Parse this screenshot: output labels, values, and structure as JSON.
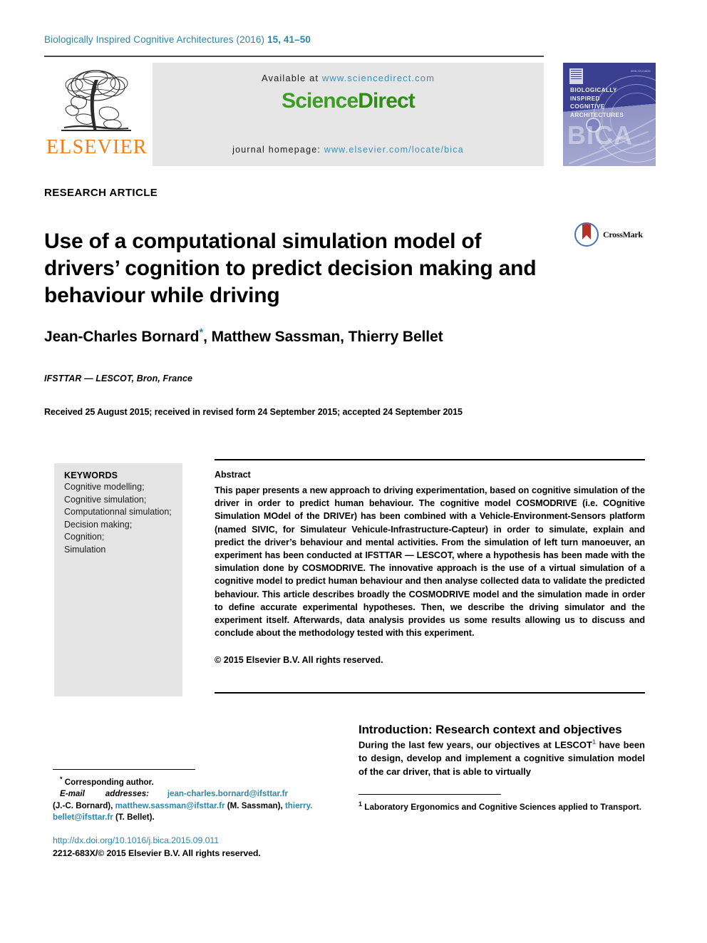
{
  "running_head": {
    "journal": "Biologically Inspired Cognitive Architectures",
    "year": "(2016)",
    "volpages": "15, 41–50"
  },
  "masthead": {
    "publisher": "ELSEVIER",
    "available_prefix": "Available at ",
    "available_url": "www.sciencedirect.com",
    "sciencedirect_part1": "Science",
    "sciencedirect_part2": "Direct",
    "homepage_prefix": "journal homepage: ",
    "homepage_url": "www.elsevier.com/locate/bica"
  },
  "cover": {
    "issn": "ISSN 2212-683X",
    "title_line1": "BIOLOGICALLY",
    "title_line2": "INSPIRED",
    "title_line3": "COGNITIVE",
    "title_line4": "ARCHITECTURES",
    "watermark": "BICA"
  },
  "article": {
    "type": "RESEARCH ARTICLE",
    "title": "Use of a computational simulation model of drivers’ cognition to predict decision making and behaviour while driving",
    "crossmark_label": "CrossMark",
    "authors": "Jean-Charles Bornard",
    "authors_rest": ", Matthew Sassman, Thierry Bellet",
    "corresponding_marker": "*",
    "affiliation": "IFSTTAR — LESCOT, Bron, France",
    "history": "Received 25 August 2015; received in revised form 24 September 2015; accepted 24 September 2015"
  },
  "keywords": {
    "heading": "KEYWORDS",
    "items": [
      "Cognitive modelling;",
      "Cognitive simulation;",
      "Computationnal simulation;",
      "Decision making;",
      "Cognition;",
      "Simulation"
    ]
  },
  "abstract": {
    "heading": "Abstract",
    "body": "This paper presents a new approach to driving experimentation, based on cognitive simulation of the driver in order to predict human behaviour. The cognitive model COSMODRIVE (i.e. COgnitive Simulation MOdel of the DRIVEr) has been combined with a Vehicle-Environment-Sensors platform (named SIVIC, for Simulateur Vehicule-Infrastructure-Capteur) in order to simulate, explain and predict the driver’s behaviour and mental activities. From the simulation of left turn manoeuver, an experiment has been conducted at IFSTTAR — LESCOT, where a hypothesis has been made with the simulation done by COSMODRIVE. The innovative approach is the use of a virtual simulation of a cognitive model to predict human behaviour and then analyse collected data to validate the predicted behaviour. This article describes broadly the COSMODRIVE model and the simulation made in order to define accurate experimental hypotheses. Then, we describe the driving simulator and the experiment itself. Afterwards, data analysis provides us some results allowing us to discuss and conclude about the methodology tested with this experiment.",
    "copyright": "© 2015 Elsevier B.V. All rights reserved."
  },
  "introduction": {
    "heading": "Introduction: Research context and objectives",
    "paragraph_part1": "During the last few years, our objectives at LESCOT",
    "footnote_marker": "1",
    "paragraph_part2": " have been to design, develop and implement a cognitive simulation model of the car driver, that is able to virtually"
  },
  "footnotes": {
    "corresponding": "Corresponding author.",
    "corresponding_marker": "*",
    "email_label": "E-mail",
    "addresses_label": "addresses:",
    "email1": "jean-charles.bornard@ifsttar.fr",
    "email1_owner": "(J.-C. Bornard), ",
    "email2": "matthew.sassman@ifsttar.fr",
    "email2_owner": " (M. Sassman), ",
    "email3a": "thierry.",
    "email3b": "bellet@ifsttar.fr",
    "email3_owner": " (T. Bellet).",
    "doi": "http://dx.doi.org/10.1016/j.bica.2015.09.011",
    "issn_copyright": "2212-683X/© 2015 Elsevier B.V. All rights reserved.",
    "right_marker": "1",
    "right_text": " Laboratory Ergonomics and Cognitive Sciences applied to Transport."
  },
  "colors": {
    "journal_teal": "#2d86a9",
    "elsevier_orange": "#f07d1a",
    "sciencedirect_green": "#3a9e22",
    "link_blue": "#3c8fb5",
    "cover_purple": "#3b3f8f",
    "crossmark_red": "#b53226",
    "crossmark_blue": "#4a6fb0"
  }
}
